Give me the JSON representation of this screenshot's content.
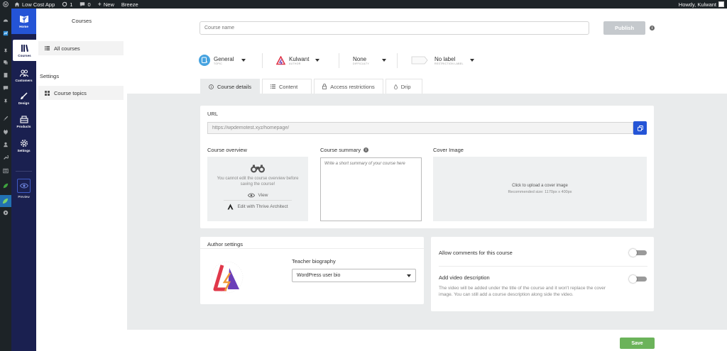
{
  "adminbar": {
    "site_name": "Low Cost App",
    "updates_count": "1",
    "comments_count": "0",
    "new_label": "New",
    "breeze_label": "Breeze",
    "howdy": "Howdy, Kulwant"
  },
  "appnav": {
    "items": [
      "Home",
      "Courses",
      "Customers",
      "Design",
      "Products",
      "Settings"
    ],
    "preview_label": "Preview"
  },
  "coursepanel": {
    "title": "Courses",
    "all_courses": "All courses",
    "settings_heading": "Settings",
    "course_topics": "Course topics"
  },
  "header": {
    "course_name_placeholder": "Course name",
    "publish_label": "Publish"
  },
  "meta": {
    "topic_value": "General",
    "topic_label": "TOPIC",
    "author_value": "Kulwant",
    "author_label": "AUTHOR",
    "difficulty_value": "None",
    "difficulty_label": "DIFFICULTY",
    "restriction_value": "No label",
    "restriction_label": "RESTRICTION LABEL"
  },
  "tabs": [
    "Course details",
    "Content",
    "Access restrictions",
    "Drip"
  ],
  "details": {
    "url_label": "URL",
    "url_value": "https://wpdemotest.xyz/homepage/",
    "overview_label": "Course overview",
    "overview_notice": "You cannot edit the course overview before saving the course!",
    "view_label": "View",
    "edit_label": "Edit with Thrive Architect",
    "summary_label": "Course summary",
    "summary_placeholder": "Write a short summary of your course here",
    "cover_label": "Cover Image",
    "cover_upload": "Click to upload a cover image",
    "cover_size": "Recommended size: 1170px x 400px"
  },
  "author_settings": {
    "title": "Author settings",
    "biography_label": "Teacher biography",
    "biography_value": "WordPress user bio"
  },
  "options": {
    "comments_label": "Allow comments for this course",
    "video_label": "Add video description",
    "video_help": "The video will be added under the title of the course and it won't replace the cover image. You can still add a course description along side the video."
  },
  "footer": {
    "save_label": "Save"
  },
  "colors": {
    "admin_bar": "#1d2327",
    "app_nav": "#1a2050",
    "accent_blue": "#2454d6",
    "save_green": "#6bb35a",
    "publish_disabled": "#c5c9cd"
  }
}
